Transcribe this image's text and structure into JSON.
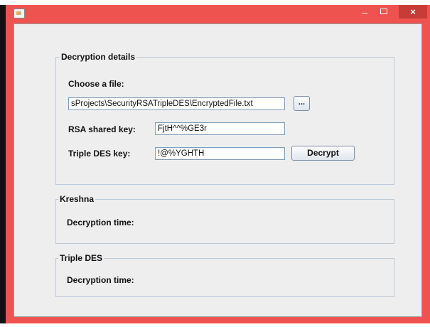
{
  "window": {
    "title": ""
  },
  "titlebar": {
    "minimize": "–",
    "close": "×"
  },
  "decryption_details": {
    "legend": "Decryption details",
    "choose_file_label": "Choose a file:",
    "file_path": "sProjects\\SecurityRSATripleDES\\EncryptedFile.txt",
    "browse_label": "...",
    "rsa_label": "RSA shared key:",
    "rsa_value": "FjtH^^%GE3r",
    "triple_des_label": "Triple DES key:",
    "triple_des_value": "!@%YGHTH",
    "decrypt_label": "Decrypt"
  },
  "kreshna": {
    "legend": "Kreshna",
    "time_label": "Decryption time:"
  },
  "triple_des": {
    "legend": "Triple DES",
    "time_label": "Decryption time:"
  }
}
